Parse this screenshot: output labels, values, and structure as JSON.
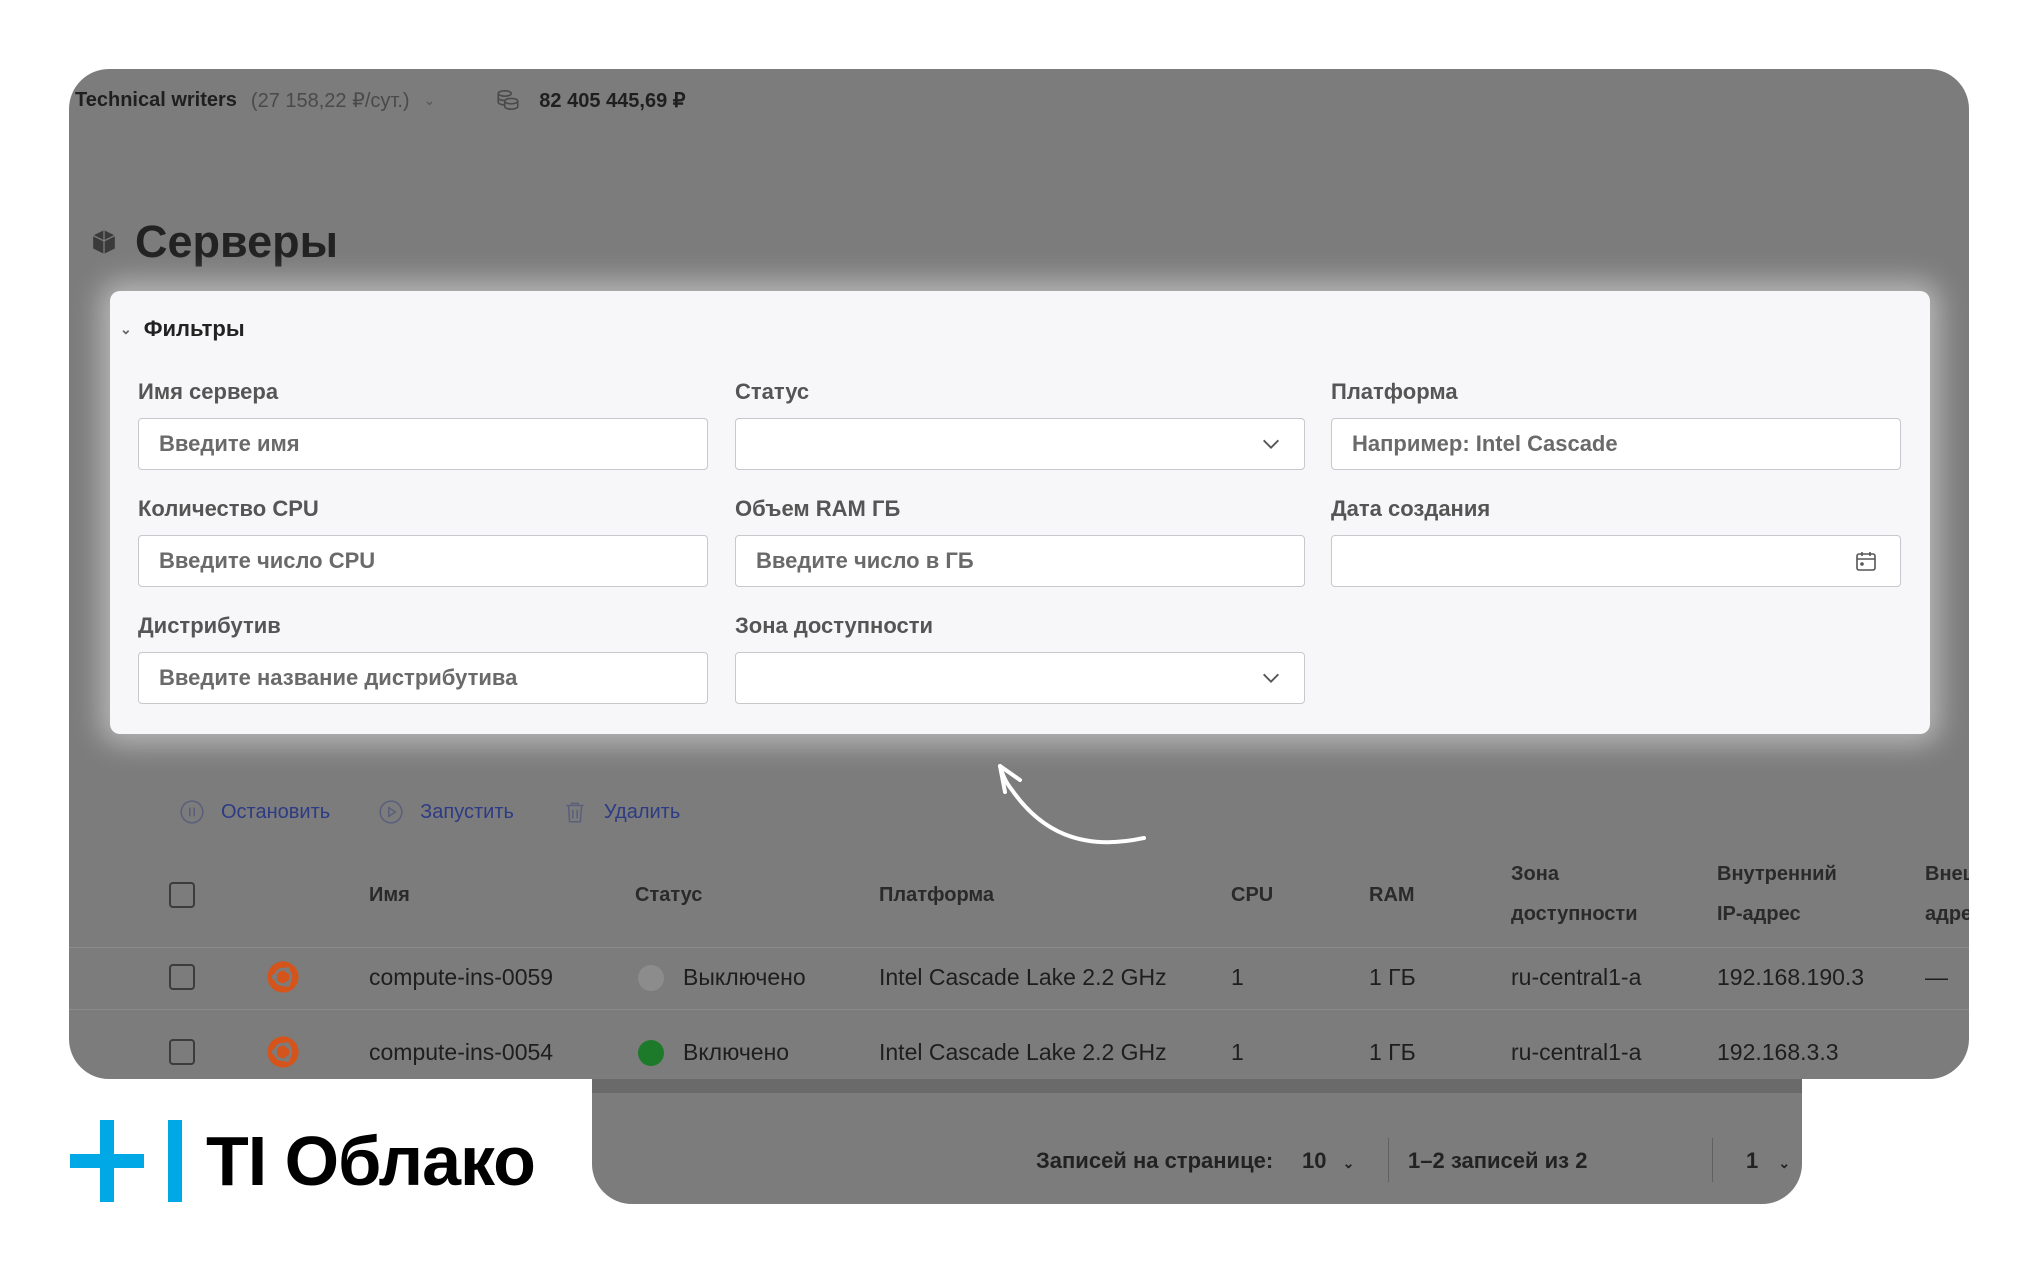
{
  "topbar": {
    "project": "Technical writers",
    "rate": "(27 158,22 ₽/сут.)",
    "balance": "82 405 445,69 ₽"
  },
  "page": {
    "title": "Серверы"
  },
  "filters": {
    "header": "Фильтры",
    "server_name": {
      "label": "Имя сервера",
      "placeholder": "Введите имя"
    },
    "status": {
      "label": "Статус",
      "value": ""
    },
    "platform": {
      "label": "Платформа",
      "placeholder": "Например: Intel Cascade"
    },
    "cpu": {
      "label": "Количество CPU",
      "placeholder": "Введите число CPU"
    },
    "ram": {
      "label": "Объем RAM ГБ",
      "placeholder": "Введите число в ГБ"
    },
    "created": {
      "label": "Дата создания",
      "value": ""
    },
    "distro": {
      "label": "Дистрибутив",
      "placeholder": "Введите название дистрибутива"
    },
    "zone": {
      "label": "Зона доступности",
      "value": ""
    }
  },
  "actions": {
    "stop": "Остановить",
    "start": "Запустить",
    "delete": "Удалить"
  },
  "table": {
    "headers": {
      "name": "Имя",
      "status": "Статус",
      "platform": "Платформа",
      "cpu": "CPU",
      "ram": "RAM",
      "zone_line1": "Зона",
      "zone_line2": "доступности",
      "internal_ip_line1": "Внутренний",
      "internal_ip_line2": "IP-адрес",
      "external_ip_line1": "Внеш",
      "external_ip_line2": "адре"
    },
    "rows": [
      {
        "name": "compute-ins-0059",
        "status": "Выключено",
        "status_color": "#8c8c8c",
        "platform": "Intel Cascade Lake 2.2 GHz",
        "cpu": "1",
        "ram": "1 ГБ",
        "zone": "ru-central1-a",
        "internal_ip": "192.168.190.3",
        "external_ip": "—"
      },
      {
        "name": "compute-ins-0054",
        "status": "Включено",
        "status_color": "#1d7a2a",
        "platform": "Intel Cascade Lake 2.2 GHz",
        "cpu": "1",
        "ram": "1 ГБ",
        "zone": "ru-central1-a",
        "internal_ip": "192.168.3.3",
        "external_ip": ""
      }
    ]
  },
  "pagination": {
    "per_page_label": "Записей на странице:",
    "per_page_value": "10",
    "range": "1–2 записей из 2",
    "page": "1"
  },
  "brand": {
    "name": "TI Облако",
    "accent": "#00a8e6",
    "icon": "plus-bar-logo"
  },
  "colors": {
    "overlay": "#7c7c7c",
    "link": "#2d3b84",
    "ubuntu": "#d4541b"
  }
}
